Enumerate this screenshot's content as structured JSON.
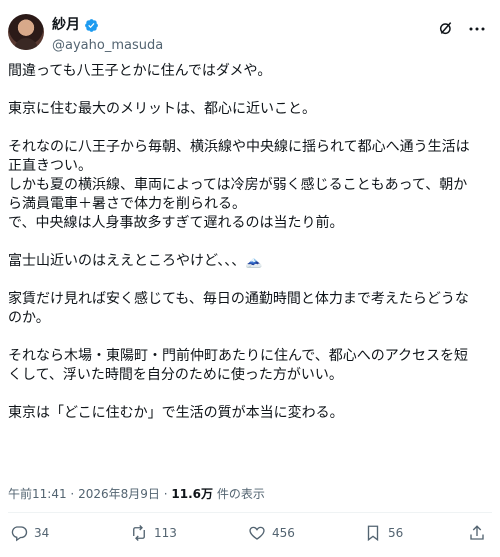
{
  "user": {
    "display_name": "紗月",
    "handle": "@ayaho_masuda"
  },
  "tweet": {
    "paragraphs": [
      "間違っても八王子とかに住んではダメや。",
      "東京に住む最大のメリットは、都心に近いこと。",
      "それなのに八王子から毎朝、横浜線や中央線に揺られて都心へ通う生活は\n正直きつい。\nしかも夏の横浜線、車両によっては冷房が弱く感じることもあって、朝か\nら満員電車＋暑さで体力を削られる。\nで、中央線は人身事故多すぎて遅れるのは当たり前。",
      "富士山近いのはええところやけど、、、🗻",
      "家賃だけ見れば安く感じても、毎日の通勤時間と体力まで考えたらどうな\nのか。",
      "それなら木場・東陽町・門前仲町あたりに住んで、都心へのアクセスを短\nくして、浮いた時間を自分のために使った方がいい。",
      "東京は「どこに住むか」で生活の質が本当に変わる。"
    ]
  },
  "meta": {
    "time": "午前11:41",
    "separator": "·",
    "date": "2026年8月9日",
    "views_count": "11.6万",
    "views_label": "件の表示"
  },
  "actions": {
    "replies": "34",
    "reposts": "113",
    "likes": "456",
    "bookmarks": "56"
  },
  "colors": {
    "verified": "#1d9bf0",
    "secondary_text": "#536471"
  }
}
